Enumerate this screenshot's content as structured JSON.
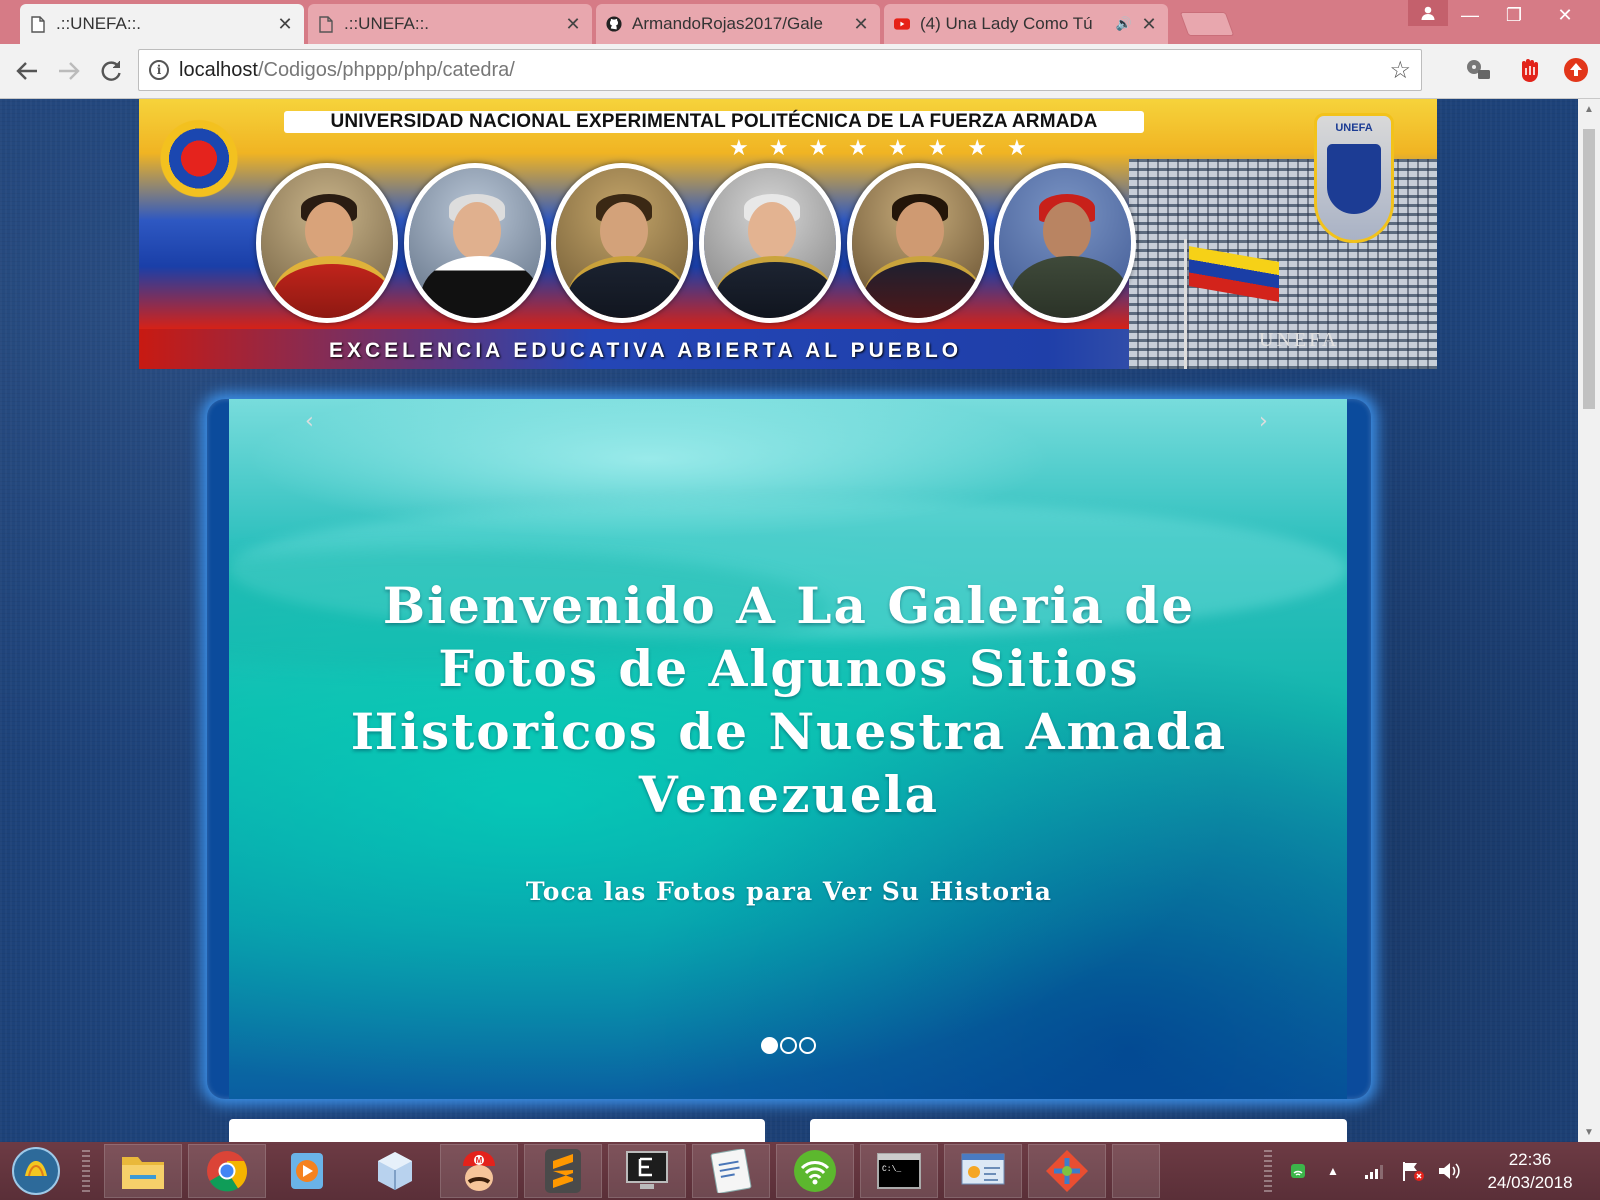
{
  "browser": {
    "tabs": [
      {
        "title": ".::UNEFA::.",
        "icon": "page-icon",
        "active": true
      },
      {
        "title": ".::UNEFA::.",
        "icon": "page-icon",
        "active": false
      },
      {
        "title": "ArmandoRojas2017/Gale",
        "icon": "github-icon",
        "active": false
      },
      {
        "title": "(4) Una Lady Como Tú",
        "icon": "youtube-icon",
        "active": false,
        "audio": true
      }
    ],
    "tab_close_glyph": "✕",
    "address": {
      "host": "localhost",
      "path": "/Codigos/phppp/php/catedra/"
    },
    "window_controls": {
      "minimize": "—",
      "restore": "❐",
      "close": "✕"
    }
  },
  "banner": {
    "title": "UNIVERSIDAD NACIONAL EXPERIMENTAL POLITÉCNICA DE LA FUERZA ARMADA",
    "motto": "EXCELENCIA EDUCATIVA ABIERTA AL PUEBLO",
    "building_sign": "UNEFA",
    "stars": "★★★★★★★★",
    "crest_label": "UNEFA"
  },
  "carousel": {
    "heading": "Bienvenido A La Galeria de Fotos de Algunos Sitios Historicos de Nuestra Amada Venezuela",
    "subheading": "Toca las Fotos para Ver Su Historia",
    "prev_glyph": "‹",
    "next_glyph": "›",
    "slides": 3,
    "active_slide": 1
  },
  "taskbar": {
    "apps": [
      "start-orb",
      "file-explorer",
      "chrome",
      "media-player",
      "virtualbox",
      "mario-game",
      "sublime-text",
      "eclipse-terminal",
      "wifi-backup-manager",
      "wifi-hotspot",
      "command-prompt",
      "network-tool",
      "git-gui"
    ],
    "clock": {
      "time": "22:36",
      "date": "24/03/2018"
    }
  },
  "colors": {
    "titlebar": "#d67b86",
    "page_bg": "#1d4279",
    "carousel_frame": "#0b4b9c",
    "taskbar": "#5a2f38"
  }
}
